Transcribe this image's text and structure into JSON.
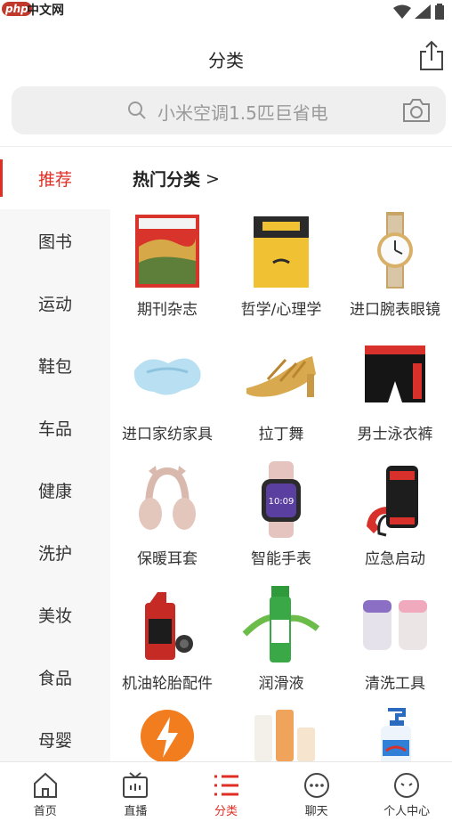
{
  "status_bar": {
    "watermark_logo": "php",
    "watermark_site": "中文网"
  },
  "header": {
    "title": "分类"
  },
  "search": {
    "placeholder": "小米空调1.5匹巨省电"
  },
  "sidebar": {
    "items": [
      {
        "label": "推荐",
        "active": true
      },
      {
        "label": "图书"
      },
      {
        "label": "运动"
      },
      {
        "label": "鞋包"
      },
      {
        "label": "车品"
      },
      {
        "label": "健康"
      },
      {
        "label": "洗护"
      },
      {
        "label": "美妆"
      },
      {
        "label": "食品"
      },
      {
        "label": "母婴"
      }
    ]
  },
  "section": {
    "title": "热门分类",
    "chevron": ">"
  },
  "categories": [
    {
      "label": "期刊杂志",
      "icon": "magazine-icon"
    },
    {
      "label": "哲学/心理学",
      "icon": "book-icon"
    },
    {
      "label": "进口腕表眼镜",
      "icon": "watch-icon"
    },
    {
      "label": "进口家纺家具",
      "icon": "pillow-icon"
    },
    {
      "label": "拉丁舞",
      "icon": "dance-shoe-icon"
    },
    {
      "label": "男士泳衣裤",
      "icon": "swim-trunks-icon"
    },
    {
      "label": "保暖耳套",
      "icon": "earmuff-icon"
    },
    {
      "label": "智能手表",
      "icon": "smartwatch-icon"
    },
    {
      "label": "应急启动",
      "icon": "jump-starter-icon"
    },
    {
      "label": "机油轮胎配件",
      "icon": "motor-oil-icon"
    },
    {
      "label": "润滑液",
      "icon": "lubricant-icon"
    },
    {
      "label": "清洗工具",
      "icon": "cleaning-cups-icon"
    },
    {
      "label": "",
      "icon": "lightning-icon"
    },
    {
      "label": "",
      "icon": "cosmetics-icon"
    },
    {
      "label": "",
      "icon": "hand-soap-icon"
    }
  ],
  "tabbar": {
    "items": [
      {
        "label": "首页",
        "icon": "home-icon"
      },
      {
        "label": "直播",
        "icon": "tv-icon"
      },
      {
        "label": "分类",
        "icon": "list-icon",
        "active": true
      },
      {
        "label": "聊天",
        "icon": "chat-icon"
      },
      {
        "label": "个人中心",
        "icon": "profile-icon"
      }
    ]
  },
  "colors": {
    "accent": "#e02e24",
    "sidebar_bg": "#f7f7f7",
    "search_bg": "#efefef"
  }
}
